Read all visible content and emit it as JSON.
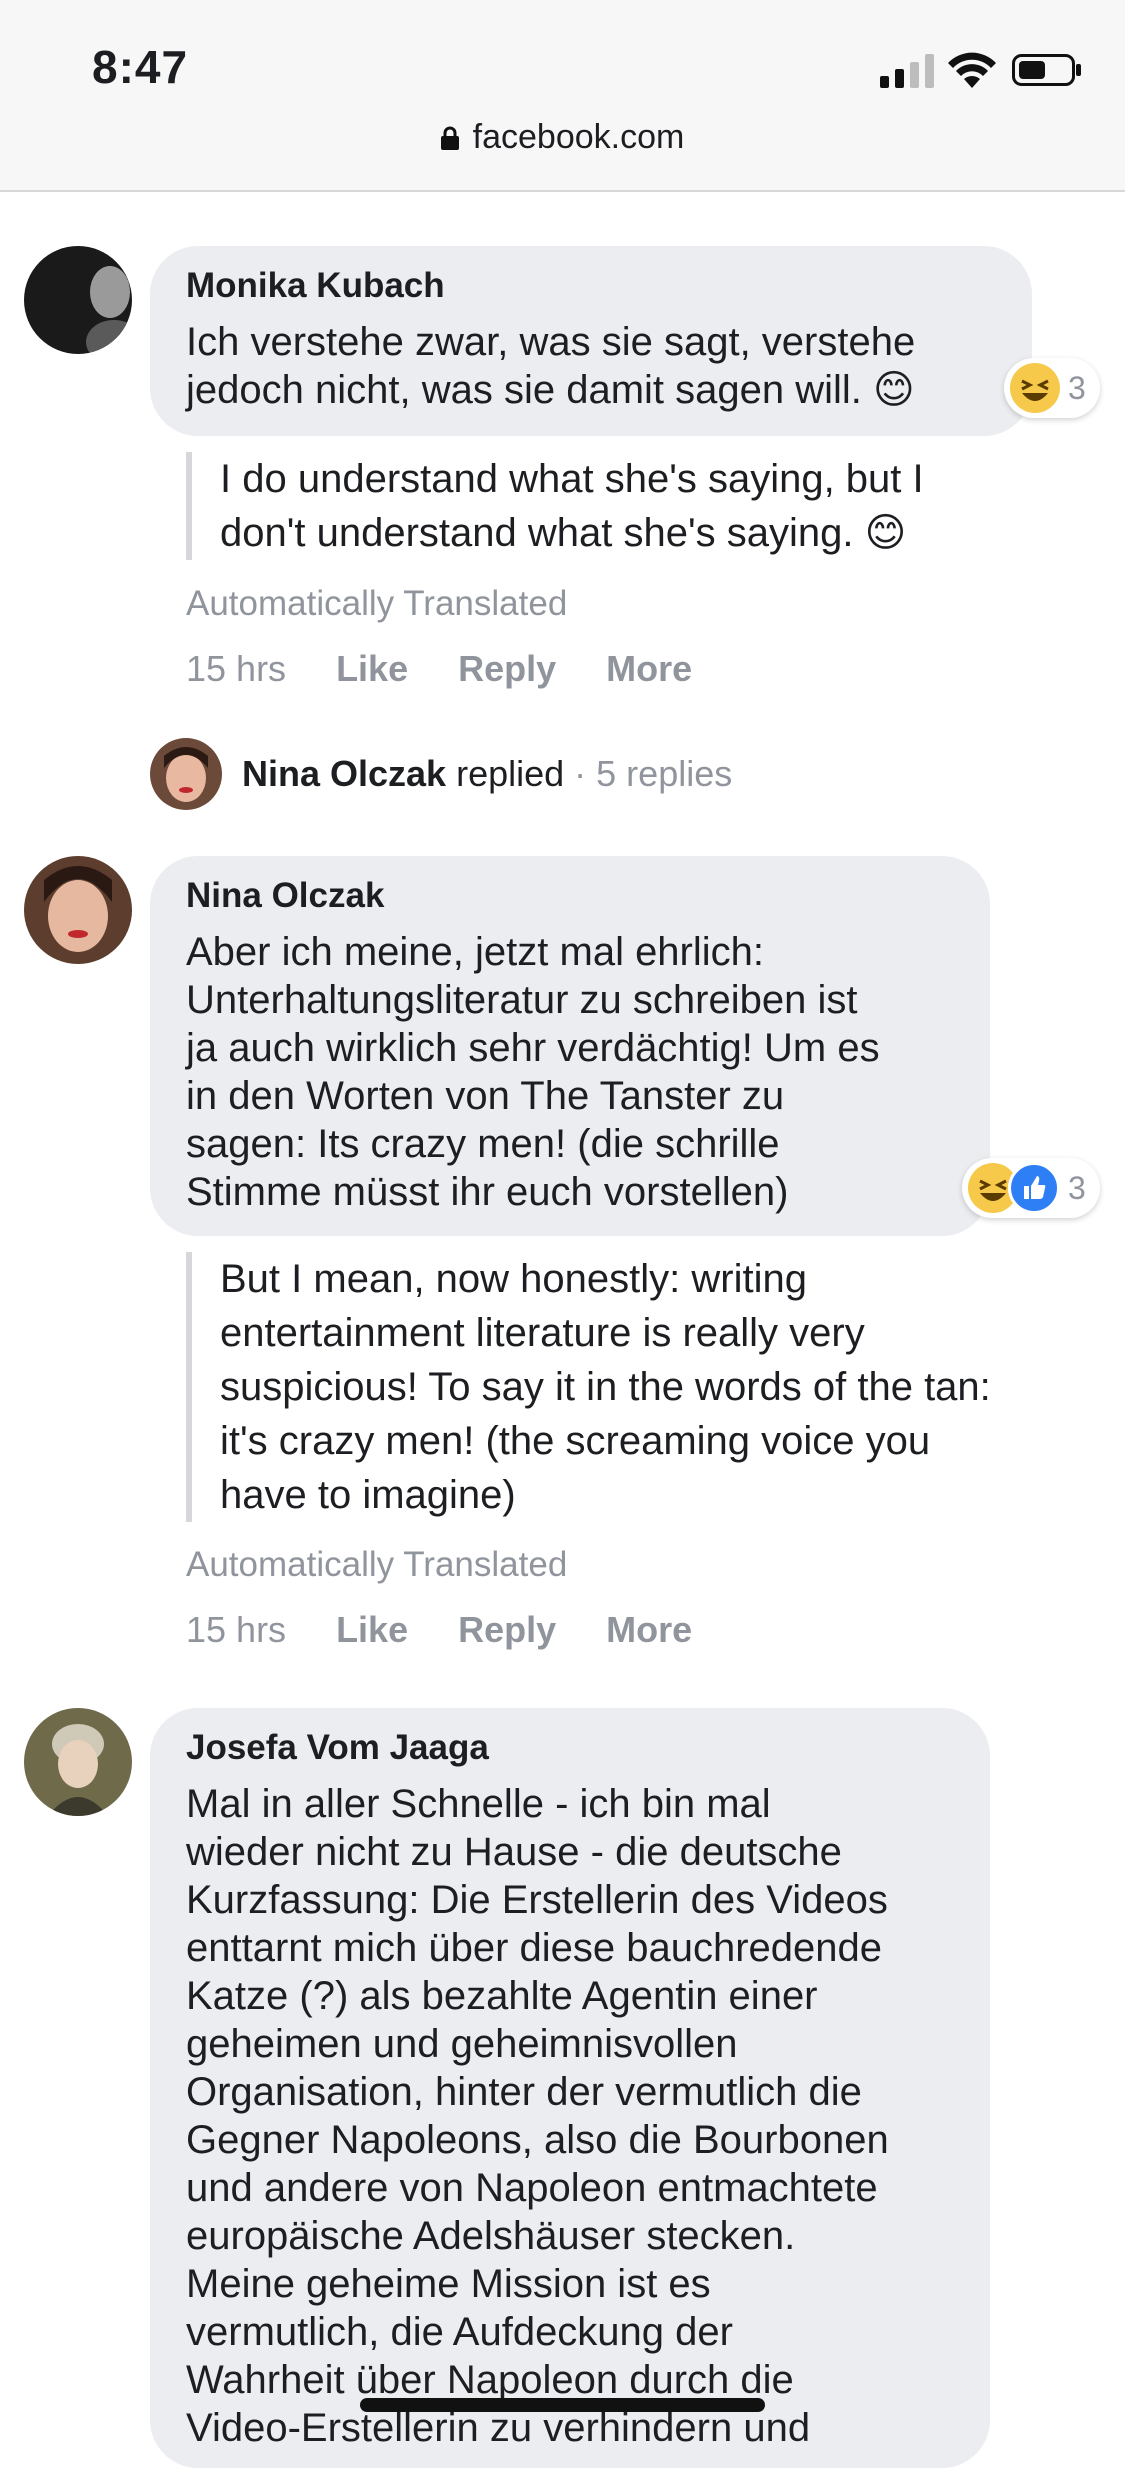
{
  "status_bar": {
    "time": "8:47",
    "url": "facebook.com"
  },
  "comments": [
    {
      "author": "Monika Kubach",
      "text": "Ich verstehe zwar, was sie sagt, verstehe\njedoch nicht, was sie damit sagen will. 😊",
      "translation": "I do understand what she's saying, but I\ndon't understand what she's saying. 😊",
      "auto_translated_label": "Automatically Translated",
      "time": "15 hrs",
      "actions": [
        "Like",
        "Reply",
        "More"
      ],
      "reactions": {
        "icons": [
          "laugh-emoji"
        ],
        "count": "3"
      }
    },
    {
      "replies_row": {
        "name": "Nina Olczak",
        "verb": "replied",
        "count": "· 5 replies"
      }
    },
    {
      "author": "Nina Olczak",
      "text": "Aber ich meine, jetzt mal ehrlich:\nUnterhaltungsliteratur zu schreiben ist\nja auch wirklich sehr verdächtig! Um es\nin den Worten von The Tanster zu\nsagen: Its crazy men! (die schrille\nStimme müsst ihr euch vorstellen)",
      "translation": "But I mean, now honestly: writing\nentertainment literature is really very\nsuspicious! To say it in the words of the tan:\nit's crazy men! (the screaming voice you\nhave to imagine)",
      "auto_translated_label": "Automatically Translated",
      "time": "15 hrs",
      "actions": [
        "Like",
        "Reply",
        "More"
      ],
      "reactions": {
        "icons": [
          "laugh-emoji",
          "like-icon"
        ],
        "count": "3"
      }
    },
    {
      "author": "Josefa Vom Jaaga",
      "text": "Mal in aller Schnelle - ich bin mal\nwieder nicht zu Hause - die deutsche\nKurzfassung: Die Erstellerin des Videos\nenttarnt mich über diese bauchredende\nKatze (?) als bezahlte Agentin einer\ngeheimen und geheimnisvollen\nOrganisation, hinter der vermutlich die\nGegner Napoleons, also die Bourbonen\nund andere von Napoleon entmachtete\neuropäische Adelshäuser stecken.\nMeine geheime Mission ist es\nvermutlich, die Aufdeckung der\nWahrheit über Napoleon durch die\nVideo-Erstellerin zu verhindern und"
    }
  ],
  "colors": {
    "bubble": "#ebedf0",
    "meta": "#90949c",
    "like_blue": "#2e7ff6",
    "laugh_yellow": "#f7c94a"
  }
}
